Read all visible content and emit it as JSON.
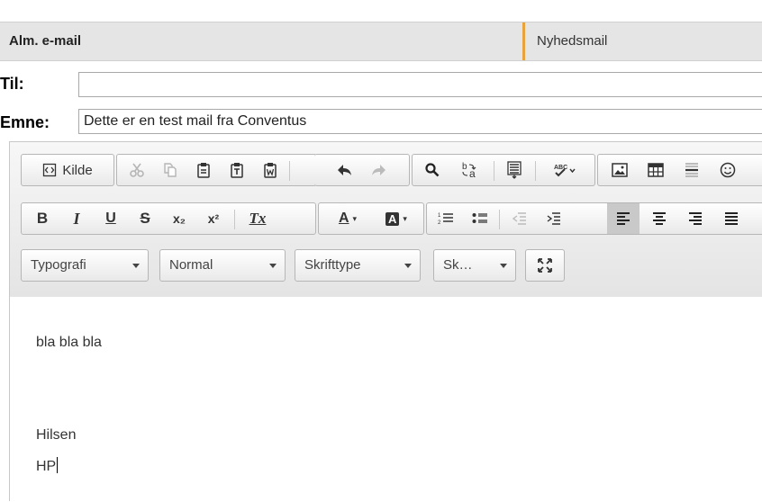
{
  "tabs": [
    {
      "label": "Alm. e-mail"
    },
    {
      "label": "Nyhedsmail"
    }
  ],
  "form": {
    "to_label": "Til:",
    "to_value": "",
    "subject_label": "Emne:",
    "subject_value": "Dette er en test mail fra Conventus"
  },
  "toolbar": {
    "source_label": "Kilde",
    "format_combo": "Typografi",
    "style_combo": "Normal",
    "font_combo": "Skrifttype",
    "size_combo": "Sk…"
  },
  "icons": {
    "bold": "B",
    "italic": "I",
    "underline": "U",
    "strike": "S",
    "subscript": "x₂",
    "superscript": "x²",
    "remove_format": "Tx",
    "text_color": "A",
    "bg_color": "A"
  },
  "content": {
    "lines": [
      "bla bla bla",
      "Hilsen",
      "HP"
    ]
  },
  "colors": {
    "tab_accent": "#e8a33d",
    "toolbar_bg": "#e9e9e9",
    "active_button": "#c9c9c9"
  }
}
